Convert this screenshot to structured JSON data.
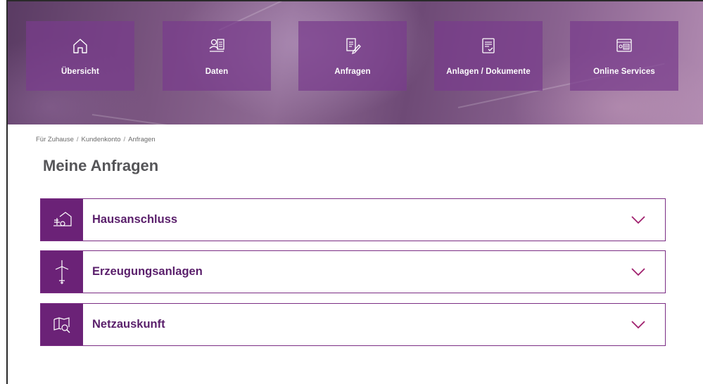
{
  "nav_tiles": [
    {
      "label": "Übersicht",
      "icon": "home-icon"
    },
    {
      "label": "Daten",
      "icon": "id-card-icon"
    },
    {
      "label": "Anfragen",
      "icon": "request-edit-icon"
    },
    {
      "label": "Anlagen / Dokumente",
      "icon": "document-check-icon"
    },
    {
      "label": "Online Services",
      "icon": "online-services-icon"
    }
  ],
  "breadcrumb": {
    "items": [
      "Für Zuhause",
      "Kundenkonto",
      "Anfragen"
    ],
    "separator": "/"
  },
  "page_title": "Meine Anfragen",
  "accordions": [
    {
      "label": "Hausanschluss",
      "icon": "house-connection-icon"
    },
    {
      "label": "Erzeugungsanlagen",
      "icon": "wind-turbine-icon"
    },
    {
      "label": "Netzauskunft",
      "icon": "map-search-icon"
    }
  ],
  "colors": {
    "brand_purple": "#6b2277",
    "tile_purple": "#783c8c",
    "accent_chevron": "#a0206e",
    "title_gray": "#555558"
  }
}
